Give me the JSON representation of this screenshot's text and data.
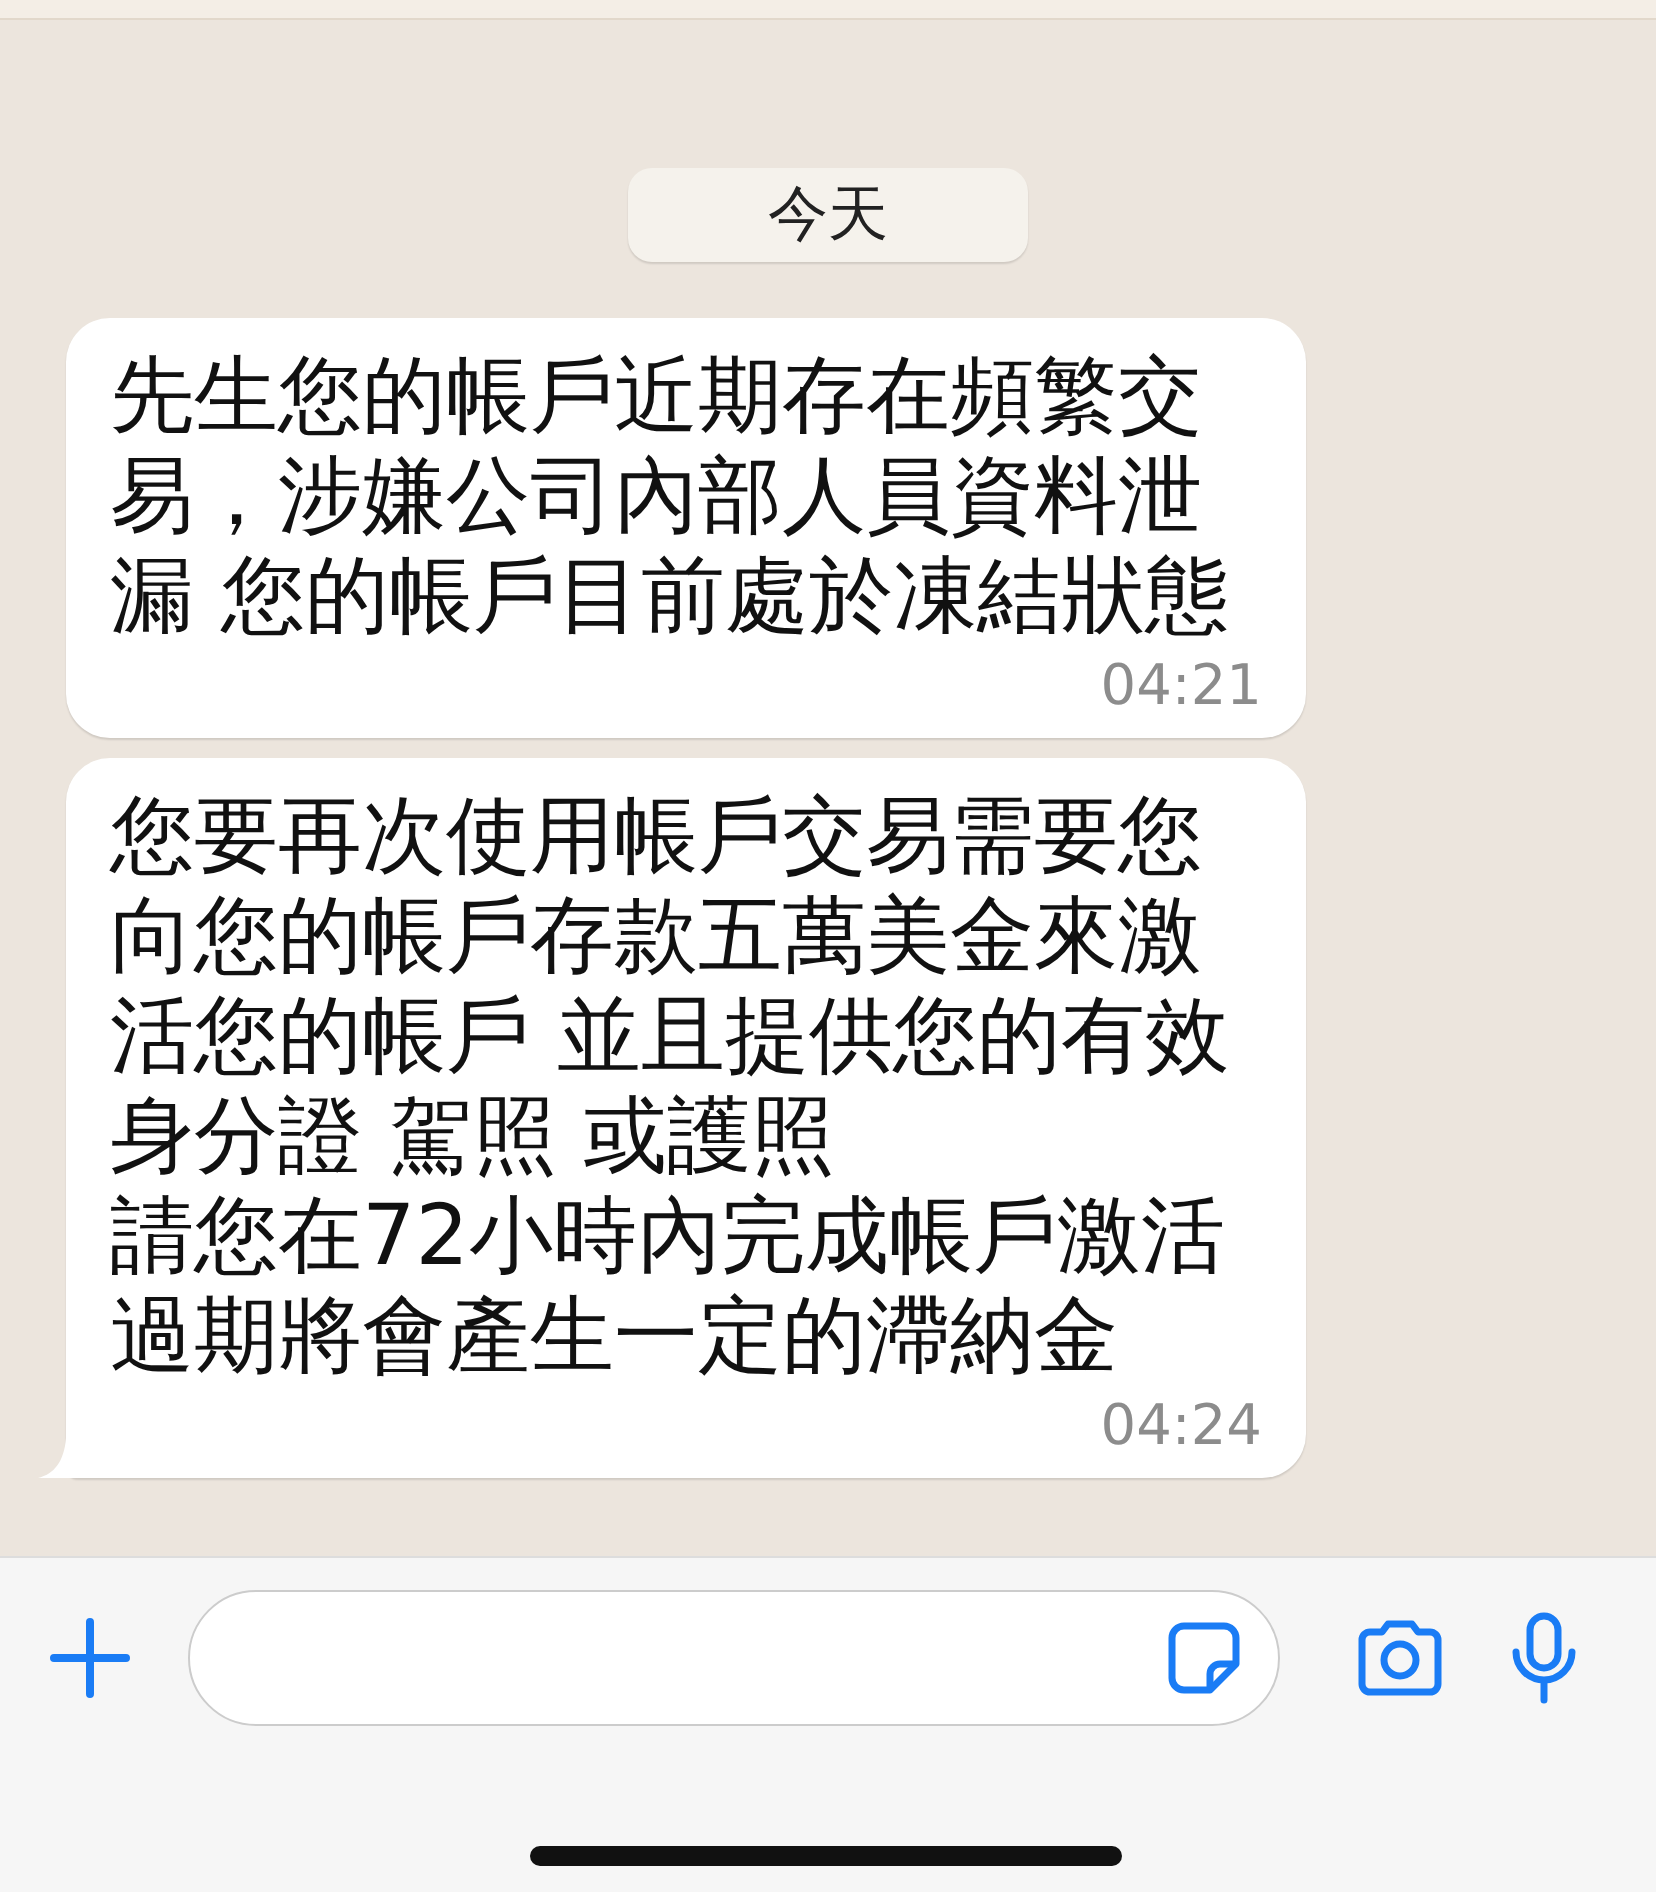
{
  "date_label": "今天",
  "messages": [
    {
      "paragraphs": [
        "先生您的帳戶近期存在頻繁交易，涉嫌公司內部人員資料泄漏 您的帳戶目前處於凍結狀態"
      ],
      "time": "04:21",
      "tail": false
    },
    {
      "paragraphs": [
        "您要再次使用帳戶交易需要您向您的帳戶存款五萬美金來激活您的帳戶 並且提供您的有效身分證 駕照 或護照",
        "請您在72小時內完成帳戶激活過期將會產生一定的滯納金"
      ],
      "time": "04:24",
      "tail": true
    }
  ]
}
